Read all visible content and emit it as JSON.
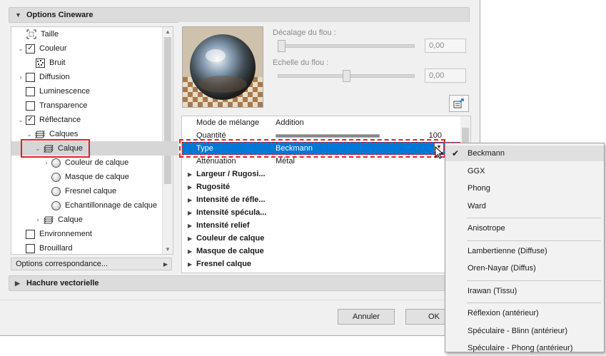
{
  "section_options": "Options Cineware",
  "tree": [
    {
      "label": "Taille",
      "kind": "icon",
      "icon": "size-icon",
      "indent": 20,
      "expand": ""
    },
    {
      "label": "Couleur",
      "kind": "check",
      "checked": true,
      "indent": 20,
      "expand": "⌄"
    },
    {
      "label": "Bruit",
      "kind": "icon",
      "icon": "noise-icon",
      "indent": 32,
      "expand": ""
    },
    {
      "label": "Diffusion",
      "kind": "check",
      "checked": false,
      "indent": 20,
      "expand": "›"
    },
    {
      "label": "Luminescence",
      "kind": "check",
      "checked": false,
      "indent": 20,
      "expand": ""
    },
    {
      "label": "Transparence",
      "kind": "check",
      "checked": false,
      "indent": 20,
      "expand": ""
    },
    {
      "label": "Réflectance",
      "kind": "check",
      "checked": true,
      "indent": 20,
      "expand": "⌄"
    },
    {
      "label": "Calques",
      "kind": "icon",
      "icon": "layers-icon",
      "indent": 32,
      "expand": "⌄"
    },
    {
      "label": "Calque",
      "kind": "icon",
      "icon": "layers-icon",
      "indent": 44,
      "expand": "⌄",
      "selected": true
    },
    {
      "label": "Couleur de calque",
      "kind": "radio",
      "indent": 56,
      "expand": "›"
    },
    {
      "label": "Masque de calque",
      "kind": "radio",
      "indent": 56,
      "expand": ""
    },
    {
      "label": "Fresnel calque",
      "kind": "radio",
      "indent": 56,
      "expand": ""
    },
    {
      "label": "Echantillonnage de calque",
      "kind": "radio",
      "indent": 56,
      "expand": ""
    },
    {
      "label": "Calque",
      "kind": "icon",
      "icon": "layers-icon",
      "indent": 44,
      "expand": "›"
    },
    {
      "label": "Environnement",
      "kind": "check",
      "checked": false,
      "indent": 20,
      "expand": ""
    },
    {
      "label": "Brouillard",
      "kind": "check",
      "checked": false,
      "indent": 20,
      "expand": ""
    }
  ],
  "options_correspondance": "Options correspondance...",
  "blur_offset_label": "Décalage du flou :",
  "blur_offset_value": "0,00",
  "blur_offset_level": 0.0,
  "blur_scale_label": "Echelle du flou :",
  "blur_scale_value": "0,00",
  "blur_scale_level": 0.5,
  "props": [
    {
      "name": "Mode de mélange",
      "value": "Addition",
      "group": false
    },
    {
      "name": "Quantité",
      "value": "",
      "bar": true,
      "bar_value": "100",
      "group": false
    },
    {
      "name": "Type",
      "value": "Beckmann",
      "group": false,
      "selected": true
    },
    {
      "name": "Atténuation",
      "value": "Métal",
      "group": false
    },
    {
      "name": "Largeur / Rugosi...",
      "group": true
    },
    {
      "name": "Rugosité",
      "group": true
    },
    {
      "name": "Intensité de réfle...",
      "group": true
    },
    {
      "name": "Intensité spécula...",
      "group": true
    },
    {
      "name": "Intensité relief",
      "group": true
    },
    {
      "name": "Couleur de calque",
      "group": true
    },
    {
      "name": "Masque de calque",
      "group": true
    },
    {
      "name": "Fresnel calque",
      "group": true
    }
  ],
  "section_hachure": "Hachure vectorielle",
  "btn_cancel": "Annuler",
  "btn_ok": "OK",
  "dropdown_groups": [
    [
      "Beckmann",
      "GGX",
      "Phong",
      "Ward"
    ],
    [
      "Anisotrope"
    ],
    [
      "Lambertienne (Diffuse)",
      "Oren-Nayar (Diffus)"
    ],
    [
      "Irawan (Tissu)"
    ],
    [
      "Réflexion (antérieur)",
      "Spéculaire - Blinn (antérieur)",
      "Spéculaire - Phong (antérieur)"
    ]
  ],
  "dropdown_checked": "Beckmann",
  "colors": {
    "selection": "#0078d7",
    "highlight_box": "#e0202a"
  }
}
